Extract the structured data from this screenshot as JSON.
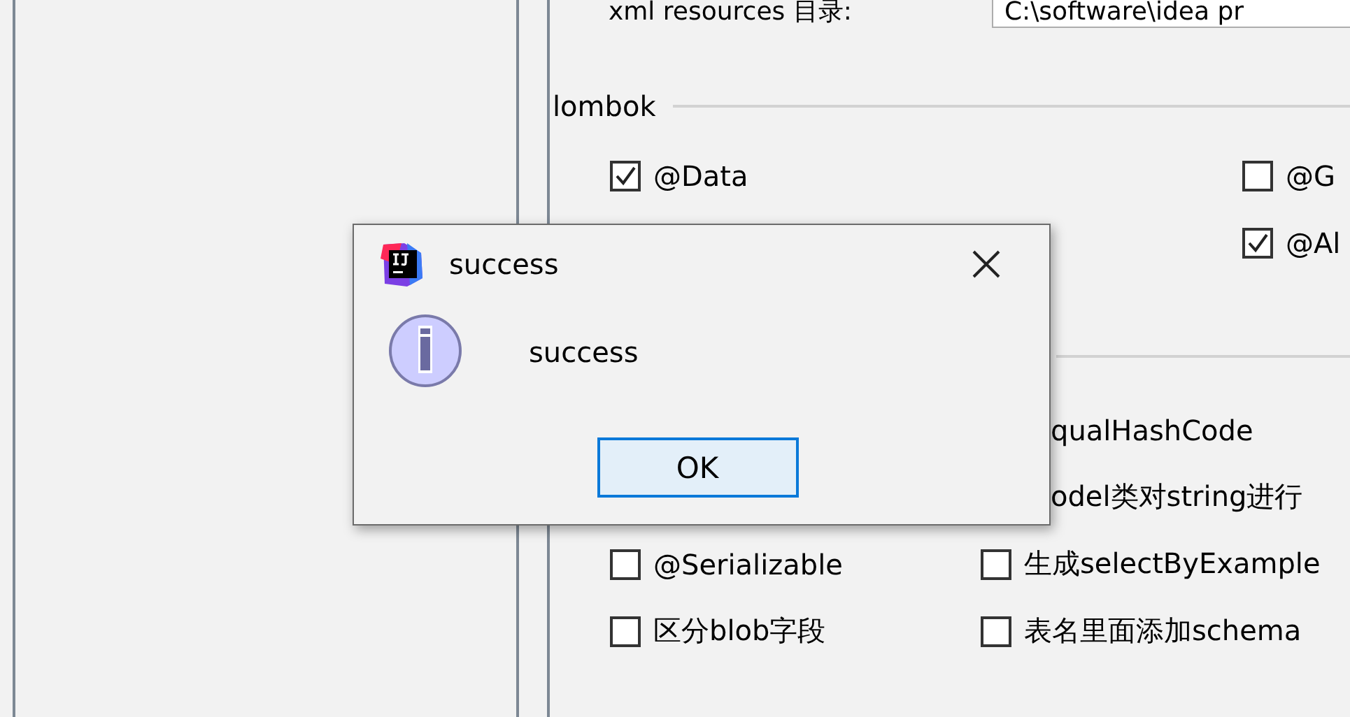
{
  "top_row": {
    "label": "xml resources 目录:",
    "field_value": "C:\\software\\idea pr"
  },
  "lombok": {
    "title": "lombok",
    "rows": [
      {
        "right_column": false,
        "items": [
          {
            "kind": "checkbox",
            "label": "@Data",
            "checked": true
          },
          {
            "kind": "checkbox",
            "label": "@G",
            "checked": false
          }
        ]
      },
      {
        "right_column": true,
        "items": [
          {
            "kind": "checkbox",
            "label": "@Al",
            "checked": true
          }
        ]
      }
    ]
  },
  "options": {
    "rows": [
      {
        "items": [
          {
            "kind": "covered",
            "label": "qualHashCode"
          }
        ]
      },
      {
        "items": [
          {
            "kind": "covered",
            "label": "odel类对string进行"
          }
        ]
      },
      {
        "items": [
          {
            "kind": "checkbox",
            "label": "@Serializable",
            "checked": false
          },
          {
            "kind": "checkbox",
            "label": "生成selectByExample",
            "checked": false
          }
        ]
      },
      {
        "items": [
          {
            "kind": "checkbox",
            "label": "区分blob字段",
            "checked": false
          },
          {
            "kind": "checkbox",
            "label": "表名里面添加schema",
            "checked": false
          }
        ]
      }
    ]
  },
  "dialog": {
    "title": "success",
    "message": "success",
    "button": "OK"
  }
}
